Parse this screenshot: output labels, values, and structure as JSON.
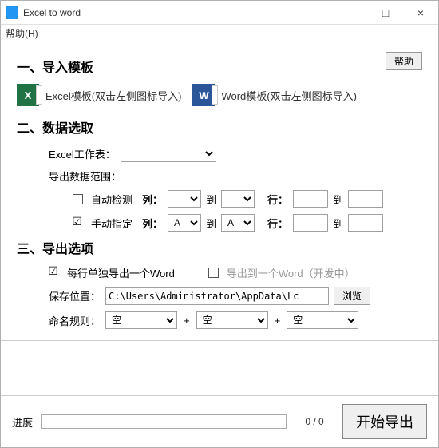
{
  "window": {
    "title": "Excel to word",
    "min": "–",
    "max": "□",
    "close": "×"
  },
  "menu": {
    "help": "帮助(H)"
  },
  "section1": {
    "title": "一、导入模板",
    "help_btn": "帮助",
    "excel_label": "Excel模板(双击左侧图标导入)",
    "word_label": "Word模板(双击左侧图标导入)",
    "excel_icon_text": "X",
    "word_icon_text": "W"
  },
  "section2": {
    "title": "二、数据选取",
    "sheet_label": "Excel工作表：",
    "range_label": "导出数据范围：",
    "auto_label": "自动检测",
    "manual_label": "手动指定",
    "col_label": "列：",
    "to_label": "到",
    "row_label": "行：",
    "col_from": "A",
    "col_to": "A"
  },
  "section3": {
    "title": "三、导出选项",
    "each_row_label": "每行单独导出一个Word",
    "single_word_label": "导出到一个Word（开发中）",
    "save_path_label": "保存位置：",
    "path_value": "C:\\Users\\Administrator\\AppData\\Lc",
    "browse_btn": "浏览",
    "naming_label": "命名规则：",
    "naming_option": "空",
    "plus": "+"
  },
  "bottom": {
    "progress_label": "进度",
    "progress_text": "0 / 0",
    "start_btn": "开始导出"
  }
}
